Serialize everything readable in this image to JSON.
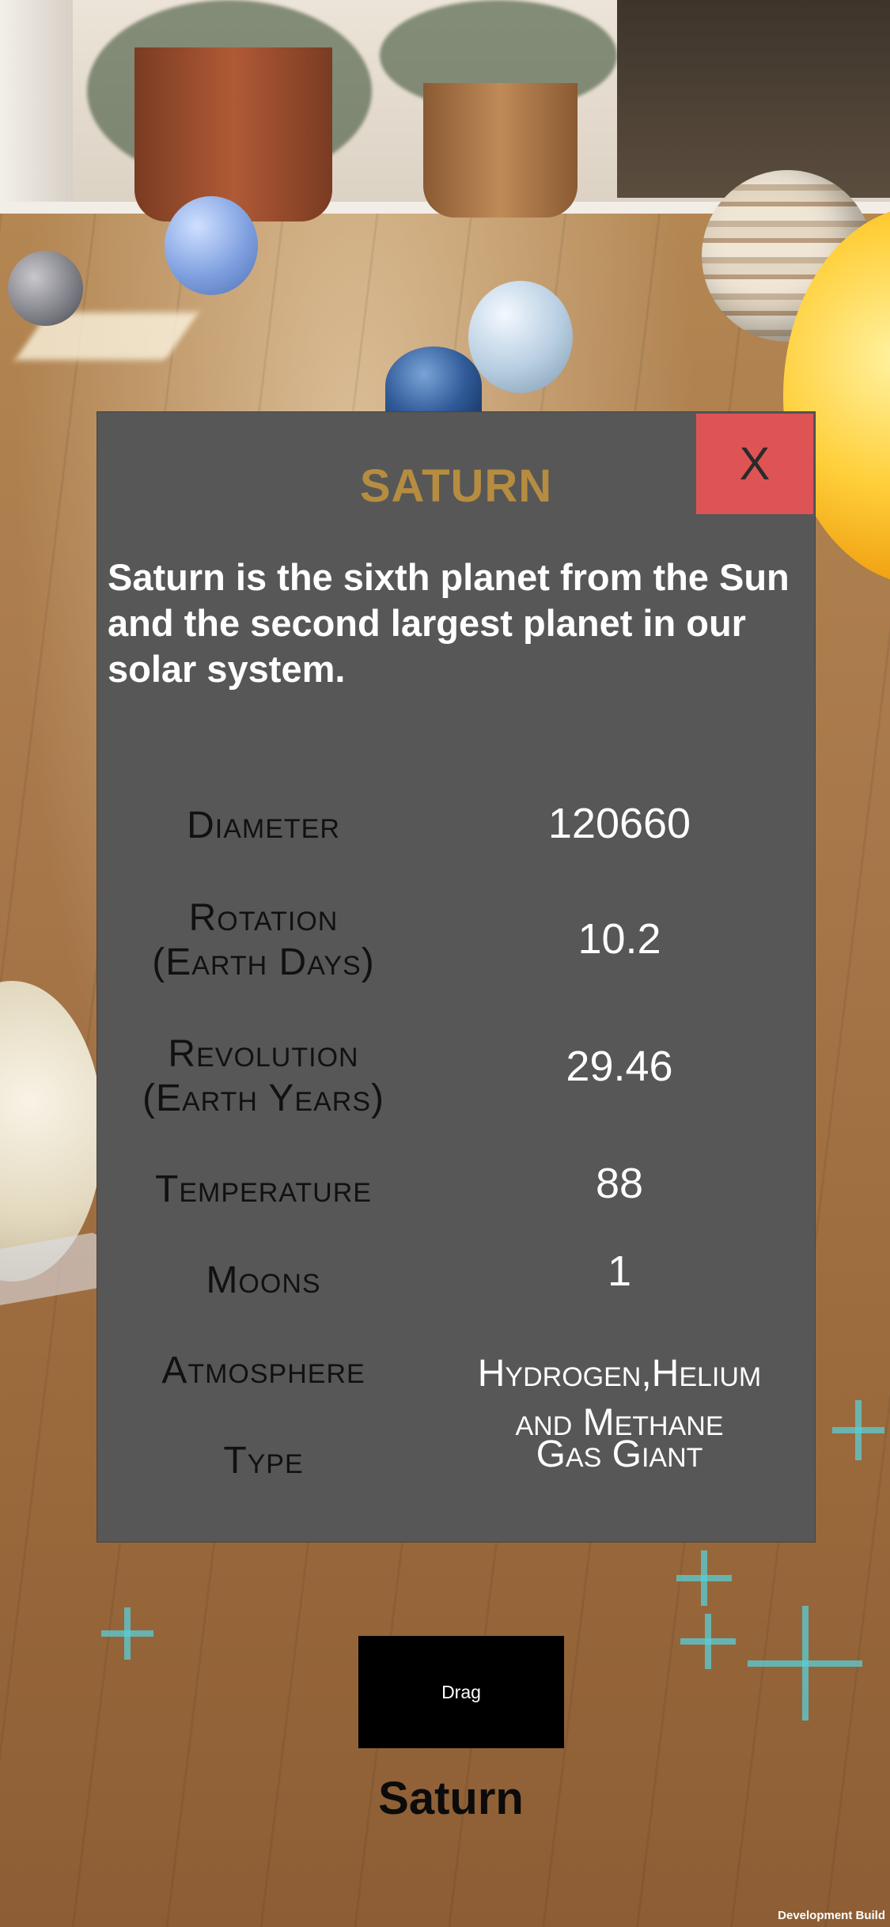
{
  "panel": {
    "title": "SATURN",
    "close_label": "X",
    "description": "Saturn is the sixth planet from the Sun and the second largest planet in our solar system.",
    "rows": [
      {
        "label": "Diameter",
        "value": "120660"
      },
      {
        "label": "Rotation",
        "label2": "(Earth Days)",
        "value": "10.2"
      },
      {
        "label": "Revolution",
        "label2": "(Earth Years)",
        "value": "29.46"
      },
      {
        "label": "Temperature",
        "value": "88"
      },
      {
        "label": "Moons",
        "value": "1"
      },
      {
        "label": "Atmosphere",
        "value": "Hydrogen,Helium",
        "value2": "and Methane"
      },
      {
        "label": "Type",
        "value": "Gas Giant"
      }
    ]
  },
  "controls": {
    "drag_label": "Drag",
    "selected_planet": "Saturn"
  },
  "footer": {
    "build_label": "Development Build"
  },
  "colors": {
    "panel_bg": "#575757",
    "title": "#b68d40",
    "close_bg": "#de5454",
    "drag_bg": "#000000"
  }
}
